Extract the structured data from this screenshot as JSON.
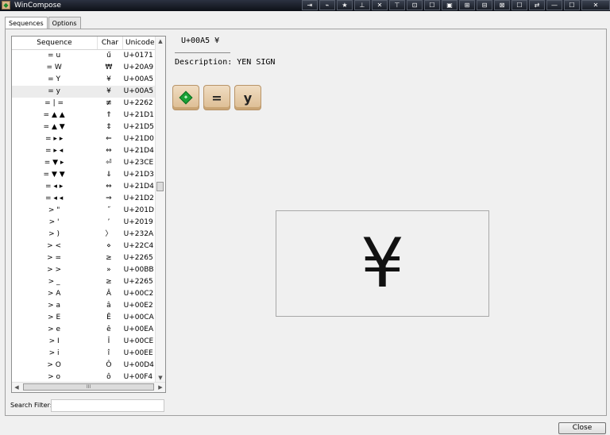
{
  "window": {
    "title": "WinCompose"
  },
  "titlebar_icons": [
    "⇥",
    "⌁",
    "★",
    "⊥",
    "✕",
    "⊤",
    "⊡",
    "☐",
    "▣",
    "⊞",
    "⊟",
    "⊠",
    "☐",
    "⇄",
    "—",
    "☐",
    "✕"
  ],
  "tabs": [
    {
      "label": "Sequences"
    },
    {
      "label": "Options"
    }
  ],
  "table": {
    "headers": {
      "sequence": "Sequence",
      "char": "Char",
      "unicode": "Unicode"
    },
    "rows": [
      {
        "seq": "= u",
        "char": "ű",
        "code": "U+0171"
      },
      {
        "seq": "= W",
        "char": "₩",
        "code": "U+20A9"
      },
      {
        "seq": "= Y",
        "char": "¥",
        "code": "U+00A5"
      },
      {
        "seq": "= y",
        "char": "¥",
        "code": "U+00A5"
      },
      {
        "seq": "= | =",
        "char": "≢",
        "code": "U+2262"
      },
      {
        "seq": "= ▲ ▲",
        "char": "⇑",
        "code": "U+21D1"
      },
      {
        "seq": "= ▲ ▼",
        "char": "⇕",
        "code": "U+21D5"
      },
      {
        "seq": "= ▸ ▸",
        "char": "⇐",
        "code": "U+21D0"
      },
      {
        "seq": "= ▸ ◂",
        "char": "⇔",
        "code": "U+21D4"
      },
      {
        "seq": "= ▼ ▸",
        "char": "⏎",
        "code": "U+23CE"
      },
      {
        "seq": "= ▼ ▼",
        "char": "⇓",
        "code": "U+21D3"
      },
      {
        "seq": "= ◂ ▸",
        "char": "⇔",
        "code": "U+21D4"
      },
      {
        "seq": "= ◂ ◂",
        "char": "⇒",
        "code": "U+21D2"
      },
      {
        "seq": "> \"",
        "char": "˝",
        "code": "U+201D"
      },
      {
        "seq": "> '",
        "char": "ʼ",
        "code": "U+2019"
      },
      {
        "seq": "> )",
        "char": "〉",
        "code": "U+232A"
      },
      {
        "seq": "> <",
        "char": "⋄",
        "code": "U+22C4"
      },
      {
        "seq": "> =",
        "char": "≥",
        "code": "U+2265"
      },
      {
        "seq": "> >",
        "char": "»",
        "code": "U+00BB"
      },
      {
        "seq": "> _",
        "char": "≥",
        "code": "U+2265"
      },
      {
        "seq": "> A",
        "char": "Â",
        "code": "U+00C2"
      },
      {
        "seq": "> a",
        "char": "â",
        "code": "U+00E2"
      },
      {
        "seq": "> E",
        "char": "Ê",
        "code": "U+00CA"
      },
      {
        "seq": "> e",
        "char": "ê",
        "code": "U+00EA"
      },
      {
        "seq": "> I",
        "char": "Î",
        "code": "U+00CE"
      },
      {
        "seq": "> i",
        "char": "î",
        "code": "U+00EE"
      },
      {
        "seq": "> O",
        "char": "Ô",
        "code": "U+00D4"
      },
      {
        "seq": "> o",
        "char": "ô",
        "code": "U+00F4"
      }
    ]
  },
  "filter": {
    "label": "Search Filter:",
    "value": ""
  },
  "detail": {
    "code_line": "U+00A5 ¥",
    "description": "Description: YEN SIGN",
    "keys": [
      "=",
      "y"
    ],
    "preview_char": "¥"
  },
  "buttons": {
    "close": "Close"
  },
  "scroll": {
    "up": "▲",
    "down": "▼",
    "left": "◀",
    "right": "▶",
    "grip": "III"
  }
}
